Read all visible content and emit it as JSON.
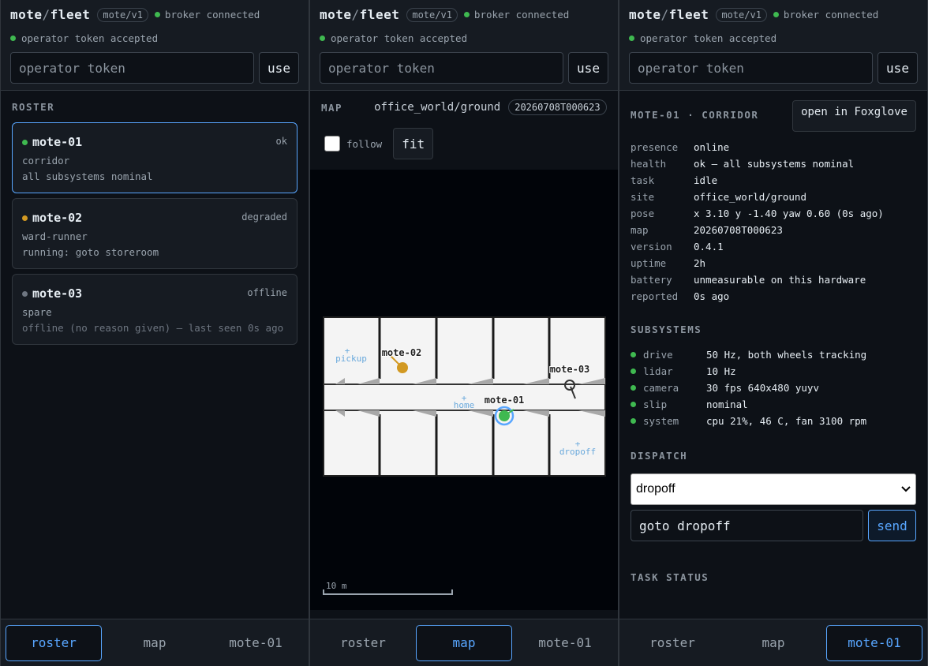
{
  "header": {
    "brand_a": "mote",
    "brand_sep": "/",
    "brand_b": "fleet",
    "protocol": "mote/v1",
    "broker_status": "broker connected",
    "token_status": "operator token accepted",
    "token_placeholder": "operator token",
    "use_label": "use"
  },
  "colors": {
    "ok": "#3fb950",
    "degraded": "#d29922",
    "offline": "#6e7681",
    "accent": "#58a6ff"
  },
  "roster": {
    "title": "ROSTER",
    "motes": [
      {
        "name": "mote-01",
        "state": "ok",
        "role": "corridor",
        "detail": "all subsystems nominal"
      },
      {
        "name": "mote-02",
        "state": "degraded",
        "role": "ward-runner",
        "detail": "running: goto storeroom"
      },
      {
        "name": "mote-03",
        "state": "offline",
        "role": "spare",
        "detail": "offline (no reason given) — last seen 0s ago"
      }
    ]
  },
  "nav": {
    "roster": "roster",
    "map": "map",
    "mote": "mote-01"
  },
  "map": {
    "title": "MAP",
    "site": "office_world/ground",
    "map_id": "20260708T000623",
    "follow_label": "follow",
    "fit_label": "fit",
    "scale_label": "10 m",
    "waypoints": {
      "pickup": "pickup",
      "home": "home",
      "dropoff": "dropoff"
    },
    "robots": {
      "r1": "mote-01",
      "r2": "mote-02",
      "r3": "mote-03"
    }
  },
  "detail": {
    "title": "MOTE-01 · CORRIDOR",
    "foxglove_label": "open in Foxglove",
    "fields": [
      {
        "k": "presence",
        "v": "online"
      },
      {
        "k": "health",
        "v": "ok — all subsystems nominal"
      },
      {
        "k": "task",
        "v": "idle"
      },
      {
        "k": "site",
        "v": "office_world/ground"
      },
      {
        "k": "pose",
        "v": "x 3.10 y -1.40 yaw 0.60 (0s ago)"
      },
      {
        "k": "map",
        "v": "20260708T000623"
      },
      {
        "k": "version",
        "v": "0.4.1"
      },
      {
        "k": "uptime",
        "v": "2h"
      },
      {
        "k": "battery",
        "v": "unmeasurable on this hardware"
      },
      {
        "k": "reported",
        "v": "0s ago"
      }
    ],
    "subsystems_title": "SUBSYSTEMS",
    "subsystems": [
      {
        "name": "drive",
        "value": "50 Hz, both wheels tracking"
      },
      {
        "name": "lidar",
        "value": "10 Hz"
      },
      {
        "name": "camera",
        "value": "30 fps 640x480 yuyv"
      },
      {
        "name": "slip",
        "value": "nominal"
      },
      {
        "name": "system",
        "value": "cpu 21%, 46 C, fan 3100 rpm"
      }
    ],
    "dispatch_title": "DISPATCH",
    "dispatch_select": "dropoff",
    "dispatch_command": "goto dropoff",
    "send_label": "send",
    "task_status_title": "TASK STATUS"
  }
}
